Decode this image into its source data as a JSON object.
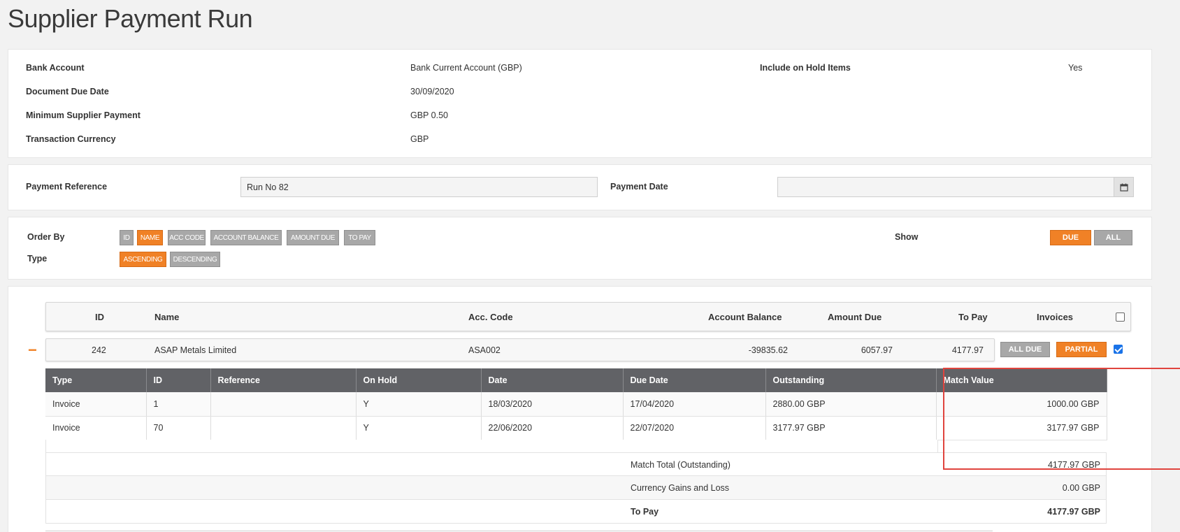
{
  "page": {
    "title": "Supplier Payment Run"
  },
  "settings": {
    "bank_account_label": "Bank Account",
    "bank_account_value": "Bank Current Account (GBP)",
    "include_hold_label": "Include on Hold Items",
    "include_hold_value": "Yes",
    "due_date_label": "Document Due Date",
    "due_date_value": "30/09/2020",
    "min_payment_label": "Minimum Supplier Payment",
    "min_payment_value": "GBP 0.50",
    "currency_label": "Transaction Currency",
    "currency_value": "GBP"
  },
  "payment": {
    "reference_label": "Payment Reference",
    "reference_value": "Run No 82",
    "date_label": "Payment Date",
    "date_value": ""
  },
  "ordering": {
    "order_by_label": "Order By",
    "order_buttons": [
      "ID",
      "NAME",
      "ACC CODE",
      "ACCOUNT BALANCE",
      "AMOUNT DUE",
      "TO PAY"
    ],
    "order_active": "NAME",
    "type_label": "Type",
    "type_buttons": [
      "ASCENDING",
      "DESCENDING"
    ],
    "type_active": "ASCENDING",
    "show_label": "Show",
    "show_buttons": [
      "DUE",
      "ALL"
    ],
    "show_active": "DUE"
  },
  "supplier_table": {
    "headers": [
      "ID",
      "Name",
      "Acc. Code",
      "Account Balance",
      "Amount Due",
      "To Pay",
      "Invoices"
    ],
    "row": {
      "id": "242",
      "name": "ASAP Metals Limited",
      "acc_code": "ASA002",
      "account_balance": "-39835.62",
      "amount_due": "6057.97",
      "to_pay": "4177.97",
      "all_due_label": "ALL DUE",
      "partial_label": "PARTIAL",
      "selected": true
    },
    "collapse_symbol": "−"
  },
  "invoice_table": {
    "headers": [
      "Type",
      "ID",
      "Reference",
      "On Hold",
      "Date",
      "Due Date",
      "Outstanding",
      "Match Value"
    ],
    "rows": [
      [
        "Invoice",
        "1",
        "",
        "Y",
        "18/03/2020",
        "17/04/2020",
        "2880.00 GBP",
        "1000.00 GBP"
      ],
      [
        "Invoice",
        "70",
        "",
        "Y",
        "22/06/2020",
        "22/07/2020",
        "3177.97 GBP",
        "3177.97 GBP"
      ]
    ]
  },
  "totals": [
    {
      "label": "Match Total (Outstanding)",
      "value": "4177.97 GBP"
    },
    {
      "label": "Currency Gains and Loss",
      "value": "0.00 GBP"
    },
    {
      "label": "To Pay",
      "value": "4177.97 GBP"
    }
  ],
  "colors": {
    "accent": "#f08126",
    "inactive": "#a8a8a8",
    "header_dark": "#616266",
    "highlight_box": "#e0443e"
  },
  "icons": {
    "date_picker": "calendar-icon"
  }
}
